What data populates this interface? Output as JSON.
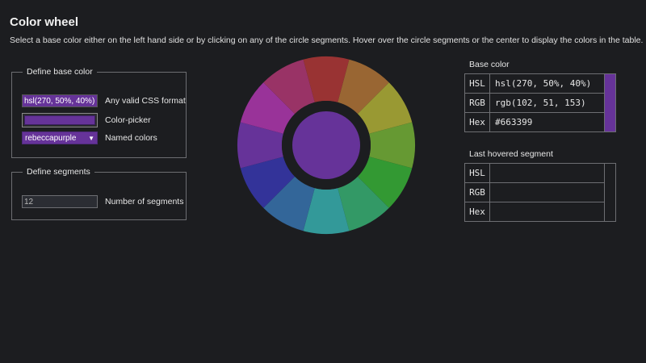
{
  "page": {
    "title": "Color wheel",
    "intro": "Select a base color either on the left hand side or by clicking on any of the circle segments. Hover over the circle segments or the center to display the colors in the table."
  },
  "base_color_fieldset": {
    "legend": "Define base color",
    "css_input": {
      "value": "hsl(270, 50%, 40%)",
      "label": "Any valid CSS format"
    },
    "color_picker": {
      "value": "#663399",
      "label": "Color-picker"
    },
    "named_select": {
      "value": "rebeccapurple",
      "label": "Named colors"
    }
  },
  "segments_fieldset": {
    "legend": "Define segments",
    "segments_input": {
      "value": "12",
      "label": "Number of segments"
    }
  },
  "wheel": {
    "segments": 12,
    "saturation": 50,
    "lightness": 40,
    "center_color": "#663399",
    "ring_color": "#1c1d20"
  },
  "base_color_table": {
    "heading": "Base color",
    "swatch": "#663399",
    "rows": [
      {
        "key": "HSL",
        "value": "hsl(270, 50%, 40%)"
      },
      {
        "key": "RGB",
        "value": "rgb(102, 51, 153)"
      },
      {
        "key": "Hex",
        "value": "#663399"
      }
    ]
  },
  "hover_table": {
    "heading": "Last hovered segment",
    "swatch": "",
    "rows": [
      {
        "key": "HSL",
        "value": ""
      },
      {
        "key": "RGB",
        "value": ""
      },
      {
        "key": "Hex",
        "value": ""
      }
    ]
  }
}
